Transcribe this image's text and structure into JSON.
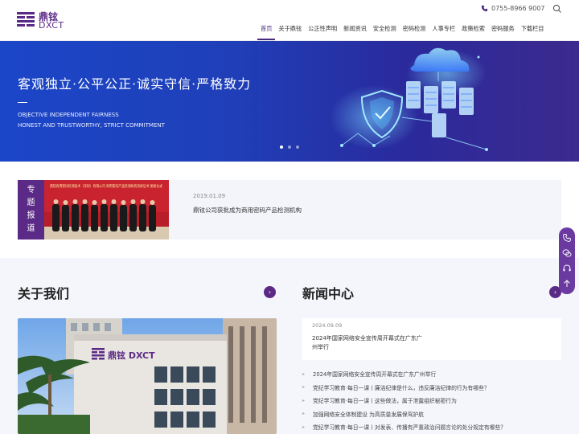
{
  "header": {
    "logo_cn": "鼎铉",
    "logo_en": "DXCT",
    "phone": "0755-8966 9007",
    "nav": [
      "首页",
      "关于鼎铉",
      "公正性声明",
      "新闻资讯",
      "安全检测",
      "密码检测",
      "人事专栏",
      "政策检索",
      "密码服务",
      "下载栏目"
    ],
    "active_nav": 0
  },
  "hero": {
    "slogan": "客观独立·公平公正·诚实守信·严格致力",
    "en_line1": "OBJECTIVE INDEPENDENT FAIRNESS",
    "en_line2": "HONEST AND TRUSTWORTHY, STRICT COMMITMENT",
    "slides": 3,
    "active_slide": 0
  },
  "special": {
    "tag_chars": [
      "专",
      "题",
      "报",
      "道"
    ],
    "photo_banner": "鼎铉商用密码检测技术（深圳）有限公司 商用密码产品检测机构资格证书 颁发仪式",
    "date": "2019.01.09",
    "title": "鼎铉公司获批成为商用密码产品检测机构"
  },
  "about": {
    "title": "关于我们",
    "building_sign": "鼎铉 DXCT"
  },
  "news": {
    "title": "新闻中心",
    "feature": {
      "date": "2024.09.09",
      "title": "2024年国家网络安全宣传周开幕式在广东广州举行"
    },
    "items": [
      "2024年国家网络安全宣传周开幕式在广东广州举行",
      "党纪学习教育·每日一课丨廉洁纪律是什么，违反廉洁纪律的行为有哪些？",
      "党纪学习教育·每日一课丨这些做法，属于泄露组织秘密行为",
      "加强网络安全体制建设 为高质量发展保驾护航",
      "党纪学习教育·每日一课丨对发表、传播有严重政治问题言论的处分规定有哪些？"
    ]
  },
  "colors": {
    "brand": "#5b2a86",
    "hero_start": "#1b46c8",
    "hero_end": "#3c2a8e",
    "section_bg": "#f4f6fc"
  }
}
